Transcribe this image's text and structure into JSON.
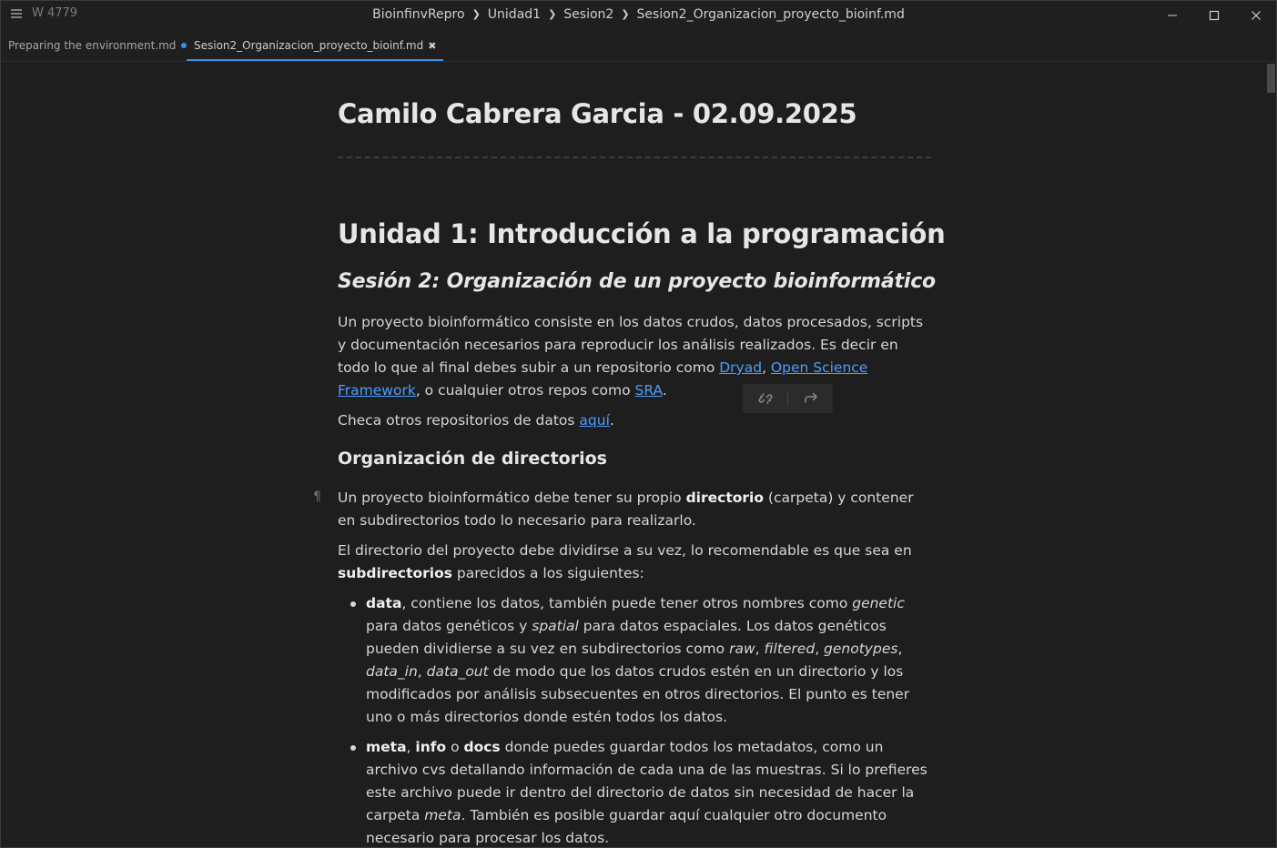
{
  "titlebar": {
    "wordcount": "W 4779",
    "breadcrumb": [
      "BioinfinvRepro",
      "Unidad1",
      "Sesion2",
      "Sesion2_Organizacion_proyecto_bioinf.md"
    ]
  },
  "tabs": [
    {
      "label": "Preparing the environment.md",
      "modified": true
    },
    {
      "label": "Sesion2_Organizacion_proyecto_bioinf.md",
      "active": true
    }
  ],
  "doc": {
    "h1": "Camilo Cabrera Garcia - 02.09.2025",
    "h2": "Unidad 1: Introducción a la programación",
    "h3": "Sesión 2: Organización de un proyecto bioinformático",
    "p1": {
      "t1": "Un proyecto bioinformático consiste en los datos crudos, datos procesados, scripts y documentación  necesarios para reproducir los análisis realizados. Es decir en todo lo que al final debes subir a un repositorio como ",
      "link1": "Dryad",
      "t2": ", ",
      "link2": "Open Science Framework",
      "t3": ", o cualquier otros repos como ",
      "link3": "SRA",
      "t4": "."
    },
    "p2": {
      "t1": "Checa otros repositorios de datos ",
      "link": "aquí",
      "t2": "."
    },
    "h4": "Organización de directorios",
    "p3": {
      "t1": "Un proyecto bioinformático debe tener su propio ",
      "b1": "directorio",
      "t2": " (carpeta) y contener en subdirectorios todo lo necesario para realizarlo."
    },
    "p4": {
      "t1": "El directorio del proyecto debe dividirse a su vez, lo recomendable es que sea en ",
      "b1": "subdirectorios",
      "t2": " parecidos a los siguientes:"
    },
    "li1": {
      "b1": "data",
      "t1": ", contiene los datos, también puede tener otros nombres como ",
      "i1": "genetic",
      "t2": " para datos genéticos y ",
      "i2": "spatial",
      "t3": " para datos espaciales. Los datos genéticos pueden dividierse a su vez en subdirectorios como ",
      "i3": "raw",
      "t4": ", ",
      "i4": "filtered",
      "t5": ", ",
      "i5": "genotypes",
      "t6": ", ",
      "i6": "data_in",
      "t7": ", ",
      "i7": "data_out",
      "t8": " de modo que los datos crudos estén en un directorio y los modificados por análisis subsecuentes en otros directorios. El punto es tener uno o más directorios donde estén todos los datos."
    },
    "li2": {
      "b1": "meta",
      "t1": ", ",
      "b2": "info",
      "t2": " o ",
      "b3": "docs",
      "t3": " donde puedes guardar todos los metadatos, como un archivo cvs detallando información de cada una de las muestras. Si lo prefieres este archivo puede ir dentro del directorio de datos sin necesidad de hacer la carpeta ",
      "i1": "meta",
      "t4": ". También es posible guardar aquí cualquier otro documento necesario para procesar los datos."
    }
  },
  "icons": {
    "menu": "hamburger-menu-icon",
    "unlink": "unlink-icon",
    "redirect": "redirect-arrow-icon",
    "pilcrow": "pilcrow-icon"
  },
  "colors": {
    "background": "#1e1e1e",
    "accent": "#3b8eea",
    "link": "#4a9eff"
  }
}
